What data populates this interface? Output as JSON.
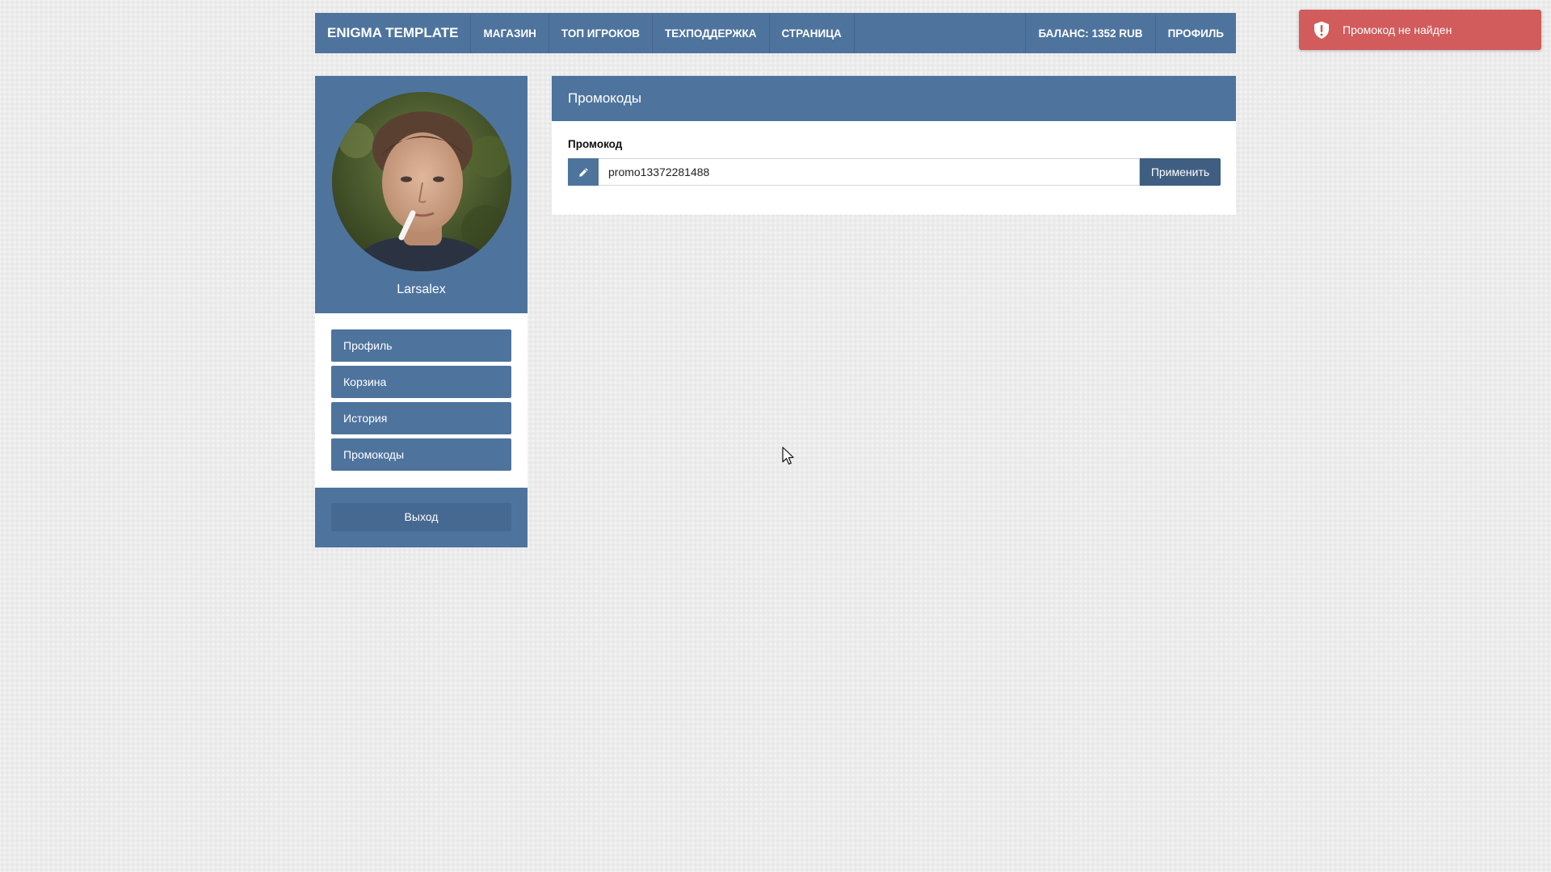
{
  "navbar": {
    "brand": "ENIGMA TEMPLATE",
    "links": [
      {
        "label": "МАГАЗИН"
      },
      {
        "label": "ТОП ИГРОКОВ"
      },
      {
        "label": "ТЕХПОДДЕРЖКА"
      },
      {
        "label": "СТРАНИЦА"
      }
    ],
    "balance": "БАЛАНС: 1352 RUB",
    "profile": "ПРОФИЛЬ"
  },
  "sidebar": {
    "username": "Larsalex",
    "menu": [
      {
        "label": "Профиль"
      },
      {
        "label": "Корзина"
      },
      {
        "label": "История"
      },
      {
        "label": "Промокоды"
      }
    ],
    "logout": "Выход"
  },
  "panel": {
    "title": "Промокоды",
    "field_label": "Промокод",
    "input_value": "promo13372281488",
    "apply_label": "Применить"
  },
  "toast": {
    "message": "Промокод не найден"
  },
  "colors": {
    "primary": "#4e749e",
    "button_dark": "#3f5e82",
    "toast_error": "#d25b5b",
    "background": "#ececec"
  },
  "icons": {
    "input_addon": "pencil-icon",
    "toast": "shield-alert-icon",
    "pointer": "mouse-cursor-icon"
  }
}
